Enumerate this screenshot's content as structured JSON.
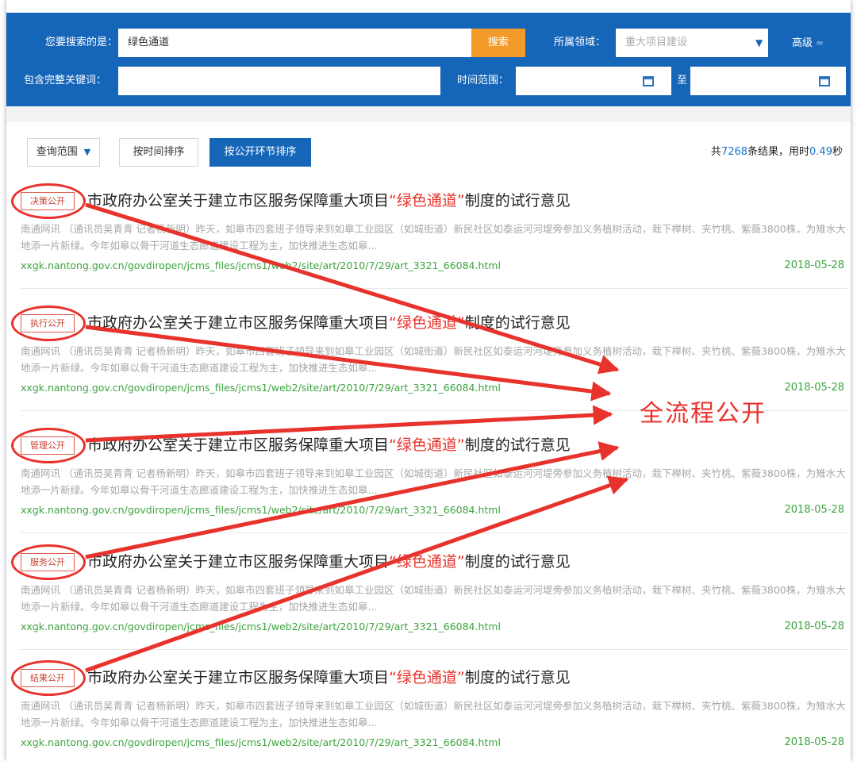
{
  "search": {
    "keyword_label": "您要搜索的是：",
    "keyword_value": "绿色通道",
    "search_button": "搜索",
    "domain_label": "所属领域：",
    "domain_placeholder": "重大项目建设",
    "advanced": "高级",
    "exact_label": "包含完整关键词：",
    "exact_value": "",
    "time_label": "时间范围：",
    "time_to": "至",
    "date_from": "",
    "date_to": ""
  },
  "toolbar": {
    "scope": "查询范围",
    "sort_time": "按时间排序",
    "sort_stage": "按公开环节排序",
    "count_prefix": "共",
    "count": "7268",
    "count_mid": "条结果，用时",
    "time": "0.49",
    "time_suffix": "秒"
  },
  "results": [
    {
      "badge": "决策公开",
      "title_before": "市政府办公室关于建立市区服务保障重大项目",
      "title_highlight": "“绿色通道”",
      "title_after": "制度的试行意见",
      "snippet": "南通网讯 （通讯员吴青青 记者杨新明）昨天，如皋市四套班子领导来到如皋工业园区（如城街道）新民社区如泰运河河堤旁参加义务植树活动，栽下榉树、夹竹桃、紫薇3800株，为雉水大地添一片新绿。今年如皋以骨干河道生态廊道建设工程为主，加快推进生态如皋...",
      "url": "xxgk.nantong.gov.cn/govdiropen/jcms_files/jcms1/web2/site/art/2010/7/29/art_3321_66084.html",
      "date": "2018-05-28"
    },
    {
      "badge": "执行公开",
      "title_before": "市政府办公室关于建立市区服务保障重大项目",
      "title_highlight": "“绿色通道”",
      "title_after": "制度的试行意见",
      "snippet": "南通网讯 （通讯员吴青青 记者杨新明）昨天，如皋市四套班子领导来到如皋工业园区（如城街道）新民社区如泰运河河堤旁参加义务植树活动，栽下榉树、夹竹桃、紫薇3800株，为雉水大地添一片新绿。今年如皋以骨干河道生态廊道建设工程为主，加快推进生态如皋...",
      "url": "xxgk.nantong.gov.cn/govdiropen/jcms_files/jcms1/web2/site/art/2010/7/29/art_3321_66084.html",
      "date": "2018-05-28"
    },
    {
      "badge": "管理公开",
      "title_before": "市政府办公室关于建立市区服务保障重大项目",
      "title_highlight": "“绿色通道”",
      "title_after": "制度的试行意见",
      "snippet": "南通网讯 （通讯员吴青青 记者杨新明）昨天，如皋市四套班子领导来到如皋工业园区（如城街道）新民社区如泰运河河堤旁参加义务植树活动，栽下榉树、夹竹桃、紫薇3800株，为雉水大地添一片新绿。今年如皋以骨干河道生态廊道建设工程为主，加快推进生态如皋...",
      "url": "xxgk.nantong.gov.cn/govdiropen/jcms_files/jcms1/web2/site/art/2010/7/29/art_3321_66084.html",
      "date": "2018-05-28"
    },
    {
      "badge": "服务公开",
      "title_before": "市政府办公室关于建立市区服务保障重大项目",
      "title_highlight": "“绿色通道”",
      "title_after": "制度的试行意见",
      "snippet": "南通网讯 （通讯员吴青青 记者杨新明）昨天，如皋市四套班子领导来到如皋工业园区（如城街道）新民社区如泰运河河堤旁参加义务植树活动，栽下榉树、夹竹桃、紫薇3800株，为雉水大地添一片新绿。今年如皋以骨干河道生态廊道建设工程为主，加快推进生态如皋...",
      "url": "xxgk.nantong.gov.cn/govdiropen/jcms_files/jcms1/web2/site/art/2010/7/29/art_3321_66084.html",
      "date": "2018-05-28"
    },
    {
      "badge": "结果公开",
      "title_before": "市政府办公室关于建立市区服务保障重大项目",
      "title_highlight": "“绿色通道”",
      "title_after": "制度的试行意见",
      "snippet": "南通网讯 （通讯员吴青青 记者杨新明）昨天，如皋市四套班子领导来到如皋工业园区（如城街道）新民社区如泰运河河堤旁参加义务植树活动，栽下榉树、夹竹桃、紫薇3800株，为雉水大地添一片新绿。今年如皋以骨干河道生态廊道建设工程为主，加快推进生态如皋...",
      "url": "xxgk.nantong.gov.cn/govdiropen/jcms_files/jcms1/web2/site/art/2010/7/29/art_3321_66084.html",
      "date": "2018-05-28"
    }
  ],
  "annotation": "全流程公开",
  "colors": {
    "header_blue": "#1565b9",
    "search_orange": "#f39a2b",
    "highlight_red": "#e8322c",
    "url_green": "#3da43f",
    "count_blue": "#1a73c7"
  }
}
